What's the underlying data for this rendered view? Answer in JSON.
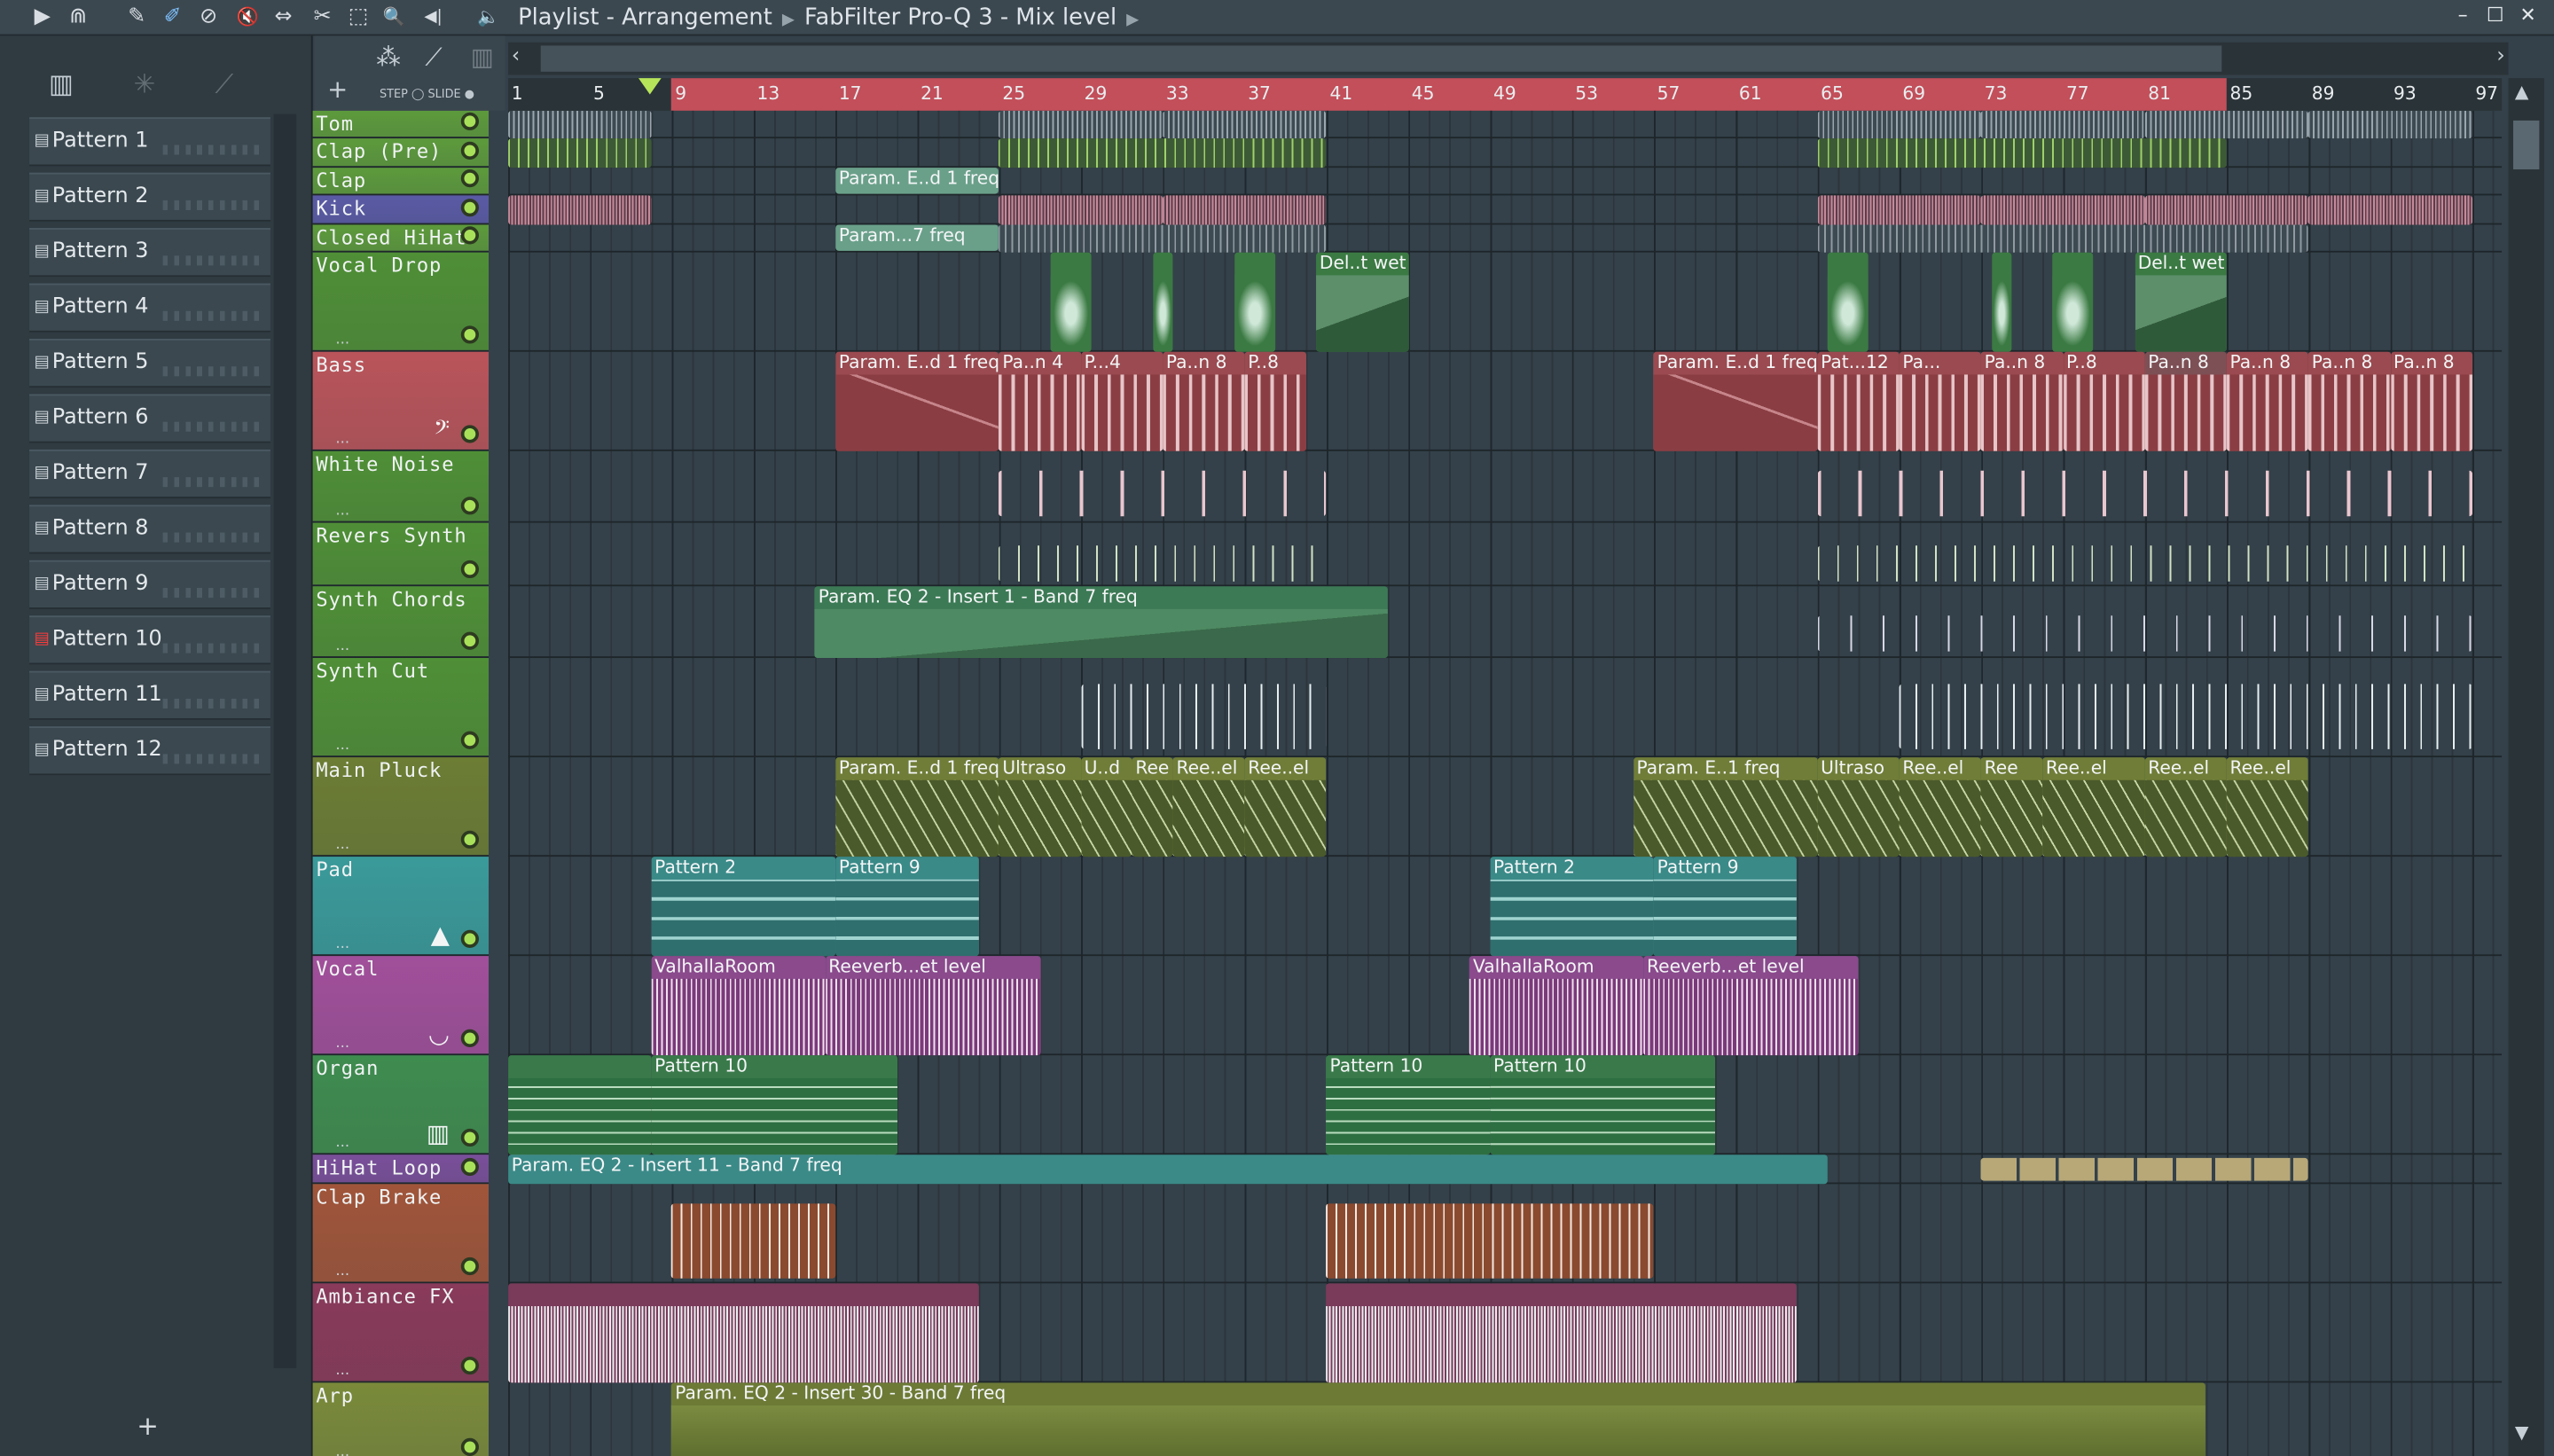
{
  "window": {
    "breadcrumb": [
      "Playlist - Arrangement",
      "FabFilter Pro-Q 3 - Mix level"
    ],
    "controls": [
      "–",
      "☐",
      "✕"
    ]
  },
  "toolbar": {
    "icons": [
      "play-icon",
      "magnet-icon",
      "pencil-icon",
      "paint-icon",
      "delete-icon",
      "mute-icon",
      "slip-icon",
      "slice-icon",
      "select-icon",
      "zoom-icon",
      "playback-icon",
      "speaker-icon"
    ],
    "glyphs": [
      "▶",
      "⋒",
      "✎",
      "✐",
      "⊘",
      "🔇",
      "⇔",
      "✂",
      "⬚",
      "🔍",
      "◀|",
      "🔈"
    ]
  },
  "picker": {
    "patterns": [
      "Pattern 1",
      "Pattern 2",
      "Pattern 3",
      "Pattern 4",
      "Pattern 5",
      "Pattern 6",
      "Pattern 7",
      "Pattern 8",
      "Pattern 9",
      "Pattern 10",
      "Pattern 11",
      "Pattern 12"
    ],
    "selected_index": 9,
    "add_label": "+"
  },
  "snap": {
    "step_label": "STEP",
    "slide_label": "SLIDE",
    "add_label": "+"
  },
  "ruler": {
    "bar_numbers": [
      "1",
      "5",
      "9",
      "13",
      "17",
      "21",
      "25",
      "29",
      "33",
      "37",
      "41",
      "45",
      "49",
      "53",
      "57",
      "61",
      "65",
      "69",
      "73",
      "77",
      "81",
      "85",
      "89",
      "93",
      "97"
    ],
    "loop_start_bar": 9,
    "loop_end_bar": 85
  },
  "tracks": [
    {
      "name": "Tom",
      "color": "#5d9a3c"
    },
    {
      "name": "Clap (Pre)",
      "color": "#5d9a3c"
    },
    {
      "name": "Clap",
      "color": "#5d9a3c"
    },
    {
      "name": "Kick",
      "color": "#5a5aa5"
    },
    {
      "name": "Closed HiHat",
      "color": "#5d9a3c"
    },
    {
      "name": "Vocal Drop",
      "color": "#4f8f36"
    },
    {
      "name": "Bass",
      "color": "#b9545a"
    },
    {
      "name": "White Noise",
      "color": "#4f8f36"
    },
    {
      "name": "Revers Synth",
      "color": "#4f8f36"
    },
    {
      "name": "Synth Chords",
      "color": "#4f8f36"
    },
    {
      "name": "Synth Cut",
      "color": "#4f8f36"
    },
    {
      "name": "Main Pluck",
      "color": "#6c7d34"
    },
    {
      "name": "Pad",
      "color": "#3a9a9a"
    },
    {
      "name": "Vocal",
      "color": "#a14f9a"
    },
    {
      "name": "Organ",
      "color": "#3f8c4f"
    },
    {
      "name": "HiHat Loop",
      "color": "#7a4f9a"
    },
    {
      "name": "Clap Brake",
      "color": "#a0553a"
    },
    {
      "name": "Ambiance FX",
      "color": "#8a3a5a"
    },
    {
      "name": "Arp",
      "color": "#7a8a3a"
    }
  ],
  "clips": {
    "clap_param": "Param. E..d 1 freq",
    "hihat_param": "Param...7 freq",
    "vocal_drop_delay": "Del..t wet",
    "bass_param": "Param. E..d 1 freq",
    "bass_pa4": "Pa..n 4",
    "bass_p4": "P...4",
    "bass_pa8": "Pa..n 8",
    "bass_p8": "P..8",
    "bass_pat12": "Pat...12",
    "bass_pa": "Pa...",
    "synth_chords_param": "Param. EQ 2 - Insert 1 - Band 7 freq",
    "pluck_param1": "Param. E..d 1 freq",
    "pluck_ultraso": "Ultraso",
    "pluck_ud": "U..d",
    "pluck_el": "el",
    "pluck_ree": "Ree",
    "pluck_reeel": "Ree..el",
    "pluck_param2": "Param. E..1 freq",
    "pad_p2": "Pattern 2",
    "pad_p9": "Pattern 9",
    "vocal_valhalla": "ValhallaRoom",
    "vocal_reverb": "Reeverb...et level",
    "organ_p10": "Pattern 10",
    "hihat_loop_param": "Param. EQ 2 - Insert 11 - Band 7 freq",
    "arp_param": "Param. EQ 2 - Insert 30 - Band 7 freq"
  }
}
